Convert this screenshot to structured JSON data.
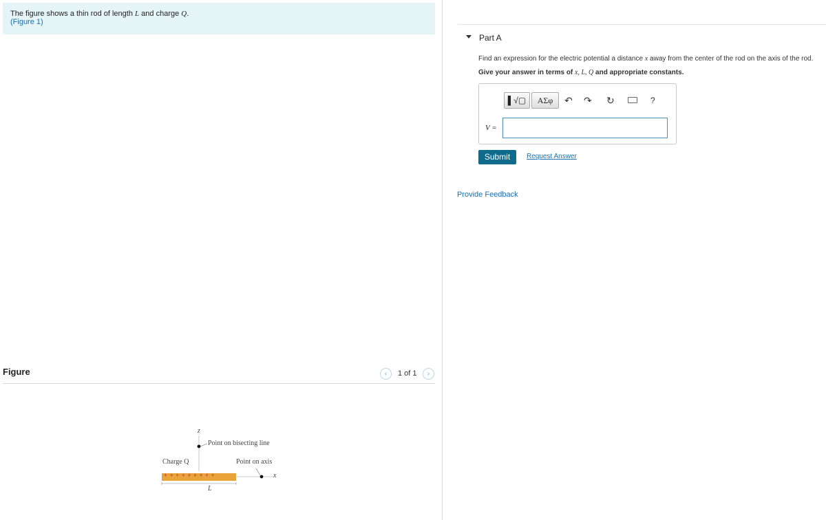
{
  "problem": {
    "text_before_L": "The figure shows a thin rod of length ",
    "var_L": "L",
    "text_and_charge": " and charge ",
    "var_Q": "Q",
    "period": ".",
    "figure_link": "(Figure 1)"
  },
  "figure_panel": {
    "title": "Figure",
    "pager_text": "1 of 1",
    "prev_icon": "‹",
    "next_icon": "›"
  },
  "figure": {
    "label_z": "z",
    "label_bisecting": "Point on bisecting line",
    "label_charge": "Charge Q",
    "label_axis": "Point on axis",
    "label_x": "x",
    "label_L": "L",
    "rod_color": "#e8a33a",
    "plus_color": "#c0392b",
    "plus_signs": "+ + + + + + + + +"
  },
  "part_a": {
    "title": "Part A",
    "question_prefix": "Find an expression for the electric potential a distance ",
    "question_var": "x",
    "question_suffix": " away from the center of the rod on the axis of the rod.",
    "instruction_prefix": "Give your answer in terms of ",
    "instruction_vars": "x, L, Q",
    "instruction_suffix": " and appropriate constants.",
    "toolbar": {
      "templates_label": "▌√▢",
      "greek_label": "ΑΣφ",
      "undo_icon": "↶",
      "redo_icon": "↷",
      "reset_icon": "↻",
      "help_label": "?"
    },
    "answer_label": "V =",
    "answer_value": "",
    "submit_label": "Submit",
    "request_answer_label": "Request Answer"
  },
  "feedback": {
    "label": "Provide Feedback"
  },
  "colors": {
    "accent_link": "#1a6fb0",
    "submit_bg": "#0e6b8c",
    "problem_bg": "#e5f4f6"
  }
}
